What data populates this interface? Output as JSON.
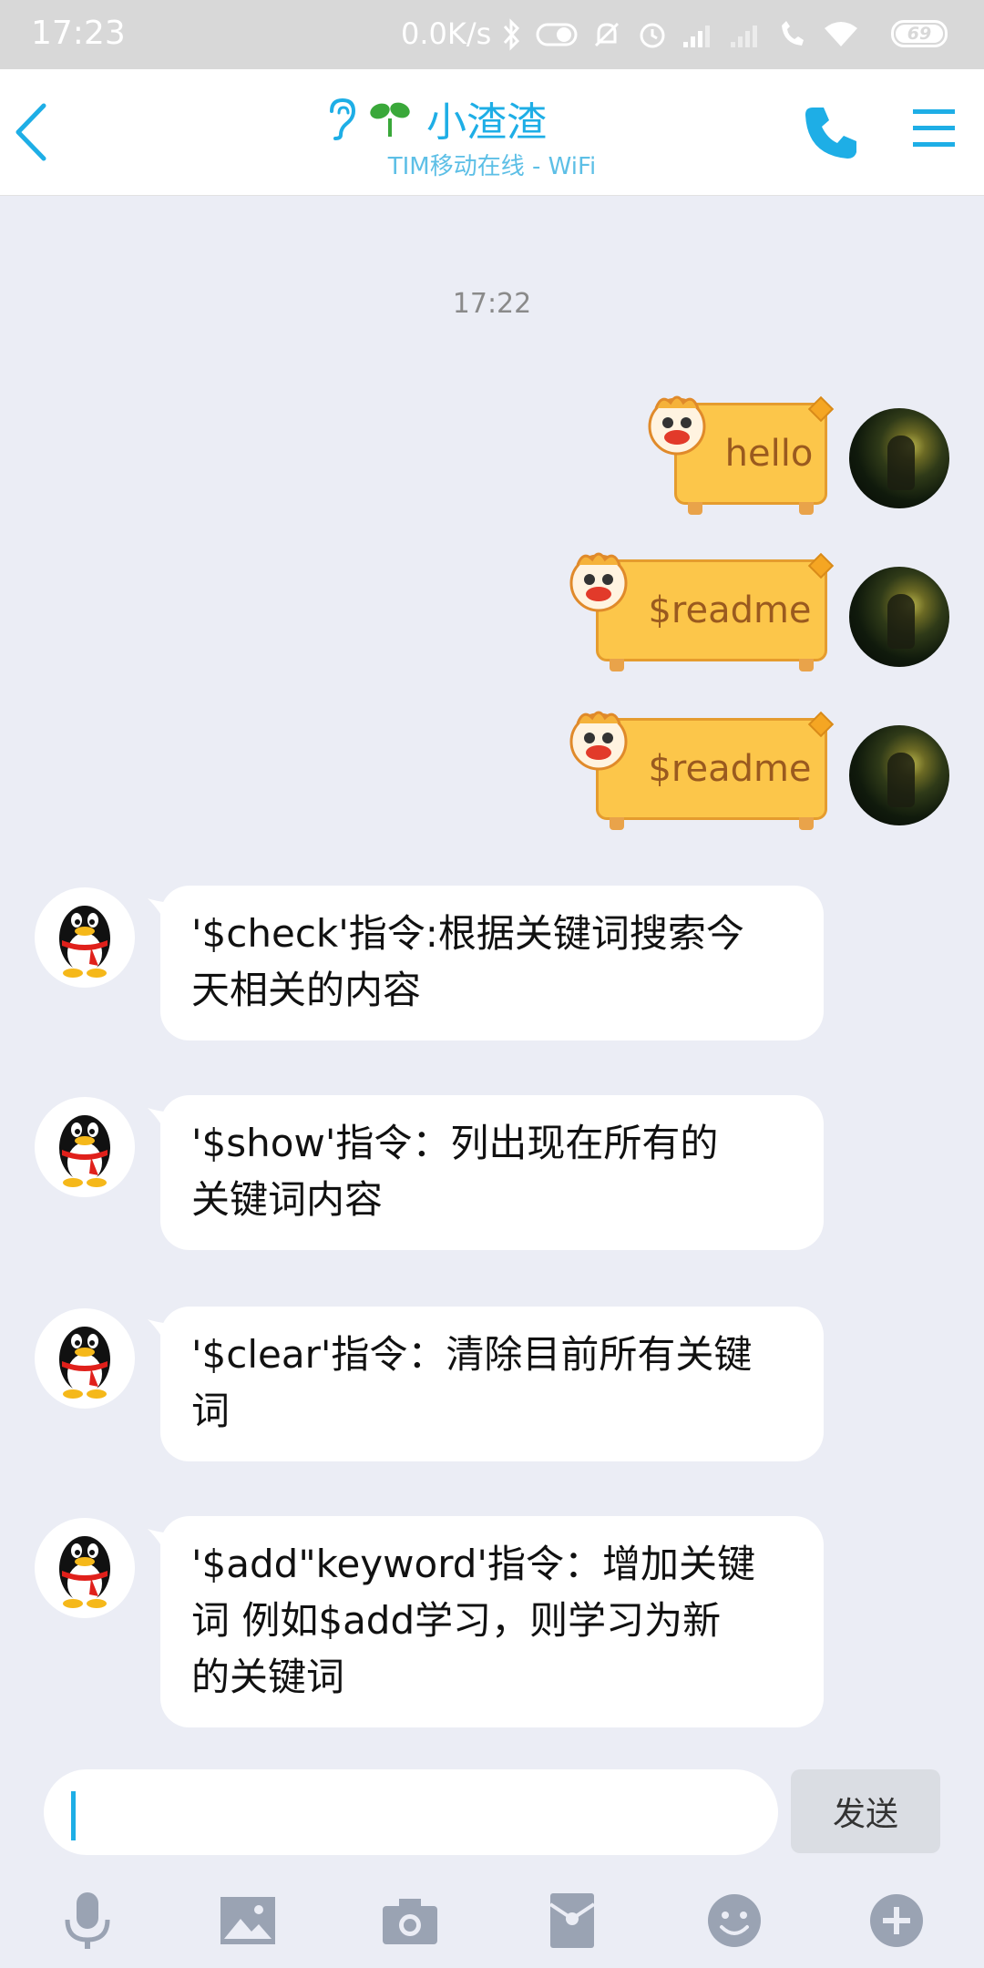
{
  "status_bar": {
    "time": "17:23",
    "net_speed": "0.0K/s",
    "battery": "69",
    "icons": [
      "bluetooth-icon",
      "toggle-icon",
      "mute-icon",
      "alarm-icon",
      "signal-icon",
      "signal-icon",
      "call-forward-icon",
      "wifi-icon"
    ]
  },
  "header": {
    "title": "小渣渣",
    "subtitle": "TIM移动在线 - WiFi",
    "accent": "#1eaee6"
  },
  "chat": {
    "timestamp": "17:22",
    "sent": [
      {
        "text": "hello"
      },
      {
        "text": "$readme"
      },
      {
        "text": "$readme"
      }
    ],
    "received": [
      {
        "lines": [
          "'$check'指令:根据关键词搜索今",
          "天相关的内容"
        ]
      },
      {
        "lines": [
          "'$show'指令：列出现在所有的",
          "关键词内容"
        ]
      },
      {
        "lines": [
          "'$clear'指令：清除目前所有关键",
          "词"
        ]
      },
      {
        "lines": [
          "'$add\"keyword'指令：增加关键",
          "词 例如$add学习，则学习为新",
          "的关键词"
        ]
      }
    ]
  },
  "input": {
    "value": "",
    "send_label": "发送"
  },
  "toolbar": {
    "icons": [
      "microphone-icon",
      "image-icon",
      "camera-icon",
      "red-packet-icon",
      "emoji-icon",
      "plus-icon"
    ]
  }
}
